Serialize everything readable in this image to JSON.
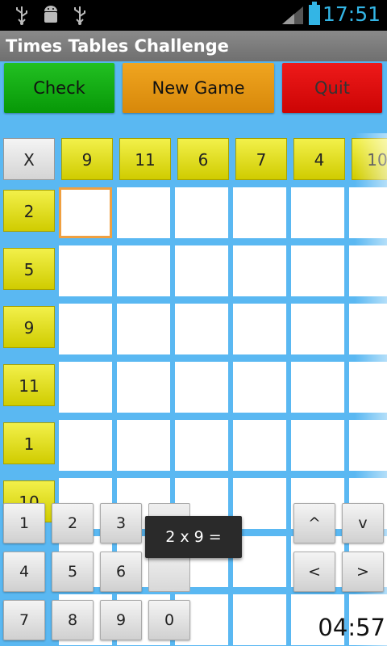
{
  "status_bar": {
    "time": "17:51",
    "icons": [
      "usb-icon",
      "android-debug-icon",
      "usb-icon",
      "signal-icon",
      "battery-icon"
    ]
  },
  "app": {
    "title": "Times Tables Challenge"
  },
  "actions": {
    "check": "Check",
    "new_game": "New Game",
    "quit": "Quit"
  },
  "grid": {
    "corner": "X",
    "columns": [
      "9",
      "11",
      "6",
      "7",
      "4",
      "10"
    ],
    "rows": [
      "2",
      "5",
      "9",
      "11",
      "1",
      "10"
    ]
  },
  "keypad": {
    "digits": [
      "1",
      "2",
      "3",
      "4",
      "5",
      "6",
      "7",
      "8",
      "9",
      "0"
    ],
    "up": "^",
    "down": "v",
    "left": "<",
    "right": ">"
  },
  "question": "2 x 9 =",
  "timer": "04:57",
  "colors": {
    "background": "#5ab8f2",
    "header_yellow": "#e8e420",
    "check_green": "#12aa12",
    "new_orange": "#e8960f",
    "quit_red": "#e00d0d",
    "active_cell": "#f0a040"
  }
}
